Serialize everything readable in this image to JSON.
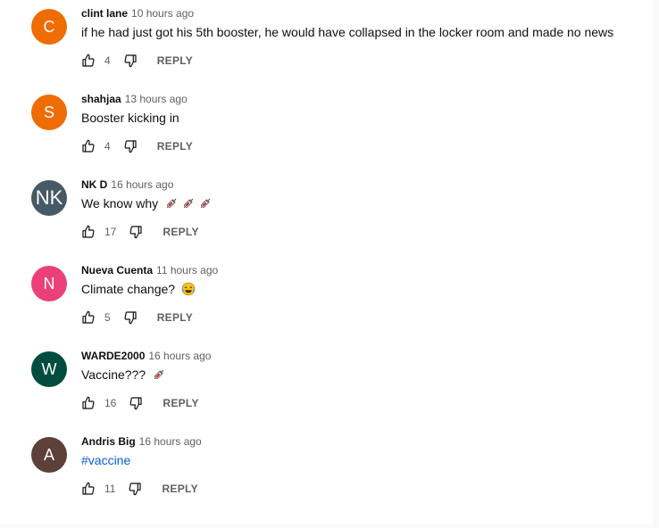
{
  "reply_label": "REPLY",
  "comments": [
    {
      "author": "clint lane",
      "time": "10 hours ago",
      "text": "if he had just got his 5th booster, he would have collapsed in the locker room and made no news",
      "likes": "4",
      "avatar_letter": "C",
      "avatar_color": "#ef6c00"
    },
    {
      "author": "shahjaa",
      "time": "13 hours ago",
      "text": "Booster kicking in",
      "likes": "4",
      "avatar_letter": "S",
      "avatar_color": "#ef6c00"
    },
    {
      "author": "NK D",
      "time": "16 hours ago",
      "text": "We know why",
      "likes": "17",
      "avatar_letter": "NK",
      "avatar_color": "#455a64",
      "emojis": [
        "syringe-emoji",
        "syringe-emoji",
        "syringe-emoji"
      ]
    },
    {
      "author": "Nueva Cuenta",
      "time": "11 hours ago",
      "text": "Climate change?",
      "likes": "5",
      "avatar_letter": "N",
      "avatar_color": "#ec407a",
      "emojis": [
        "face-with-tears-of-joy-emoji"
      ]
    },
    {
      "author": "WARDE2000",
      "time": "16 hours ago",
      "text": "Vaccine???",
      "likes": "16",
      "avatar_letter": "W",
      "avatar_color": "#004d40",
      "emojis": [
        "syringe-emoji"
      ]
    },
    {
      "author": "Andris Big",
      "time": "16 hours ago",
      "text": "#vaccine",
      "likes": "11",
      "avatar_letter": "A",
      "avatar_color": "#5d4037"
    }
  ]
}
